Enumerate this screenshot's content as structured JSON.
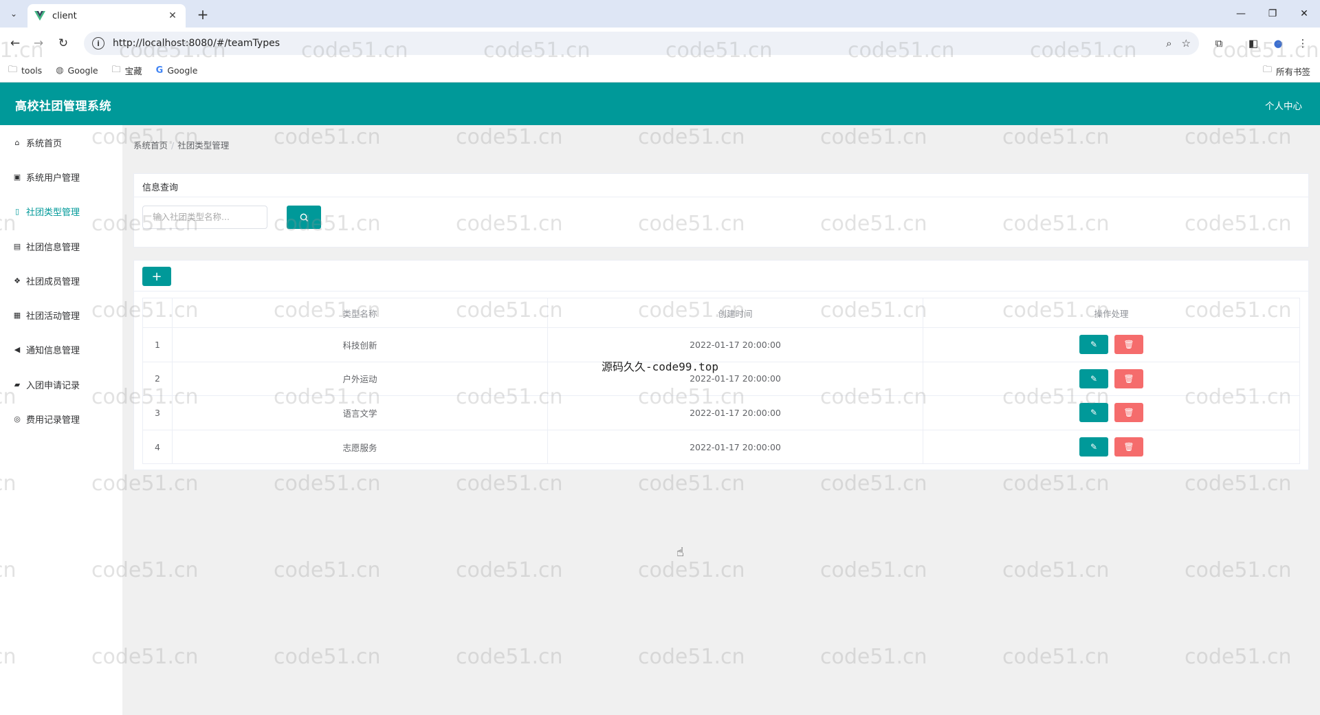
{
  "browser": {
    "tab_title": "client",
    "url": "http://localhost:8080/#/teamTypes",
    "bookmarks": [
      {
        "icon": "folder-icon",
        "label": "tools"
      },
      {
        "icon": "globe-icon",
        "label": "Google"
      },
      {
        "icon": "folder-icon",
        "label": "宝藏"
      },
      {
        "icon": "google-icon",
        "label": "Google"
      }
    ],
    "all_bookmarks_label": "所有书签"
  },
  "app": {
    "title": "高校社团管理系统",
    "user_center": "个人中心"
  },
  "sidebar": {
    "items": [
      {
        "icon": "home-icon",
        "label": "系统首页",
        "active": false
      },
      {
        "icon": "user-icon",
        "label": "系统用户管理",
        "active": false
      },
      {
        "icon": "document-icon",
        "label": "社团类型管理",
        "active": true
      },
      {
        "icon": "train-icon",
        "label": "社团信息管理",
        "active": false
      },
      {
        "icon": "cubes-icon",
        "label": "社团成员管理",
        "active": false
      },
      {
        "icon": "calculator-icon",
        "label": "社团活动管理",
        "active": false
      },
      {
        "icon": "megaphone-icon",
        "label": "通知信息管理",
        "active": false
      },
      {
        "icon": "inbox-icon",
        "label": "入团申请记录",
        "active": false
      },
      {
        "icon": "circle-icon",
        "label": "费用记录管理",
        "active": false
      }
    ]
  },
  "breadcrumb": {
    "home": "系统首页",
    "separator": "/",
    "current": "社团类型管理"
  },
  "search": {
    "title": "信息查询",
    "placeholder": "输入社团类型名称..."
  },
  "table": {
    "headers": [
      "",
      "类型名称",
      "创建时间",
      "操作处理"
    ],
    "rows": [
      {
        "index": "1",
        "name": "科技创新",
        "created": "2022-01-17 20:00:00"
      },
      {
        "index": "2",
        "name": "户外运动",
        "created": "2022-01-17 20:00:00"
      },
      {
        "index": "3",
        "name": "语言文学",
        "created": "2022-01-17 20:00:00"
      },
      {
        "index": "4",
        "name": "志愿服务",
        "created": "2022-01-17 20:00:00"
      }
    ]
  },
  "overlay_text": "源码久久-code99.top",
  "watermark": "code51.cn",
  "colors": {
    "primary": "#009999",
    "danger": "#f56c6c",
    "header_bg": "#009999"
  }
}
